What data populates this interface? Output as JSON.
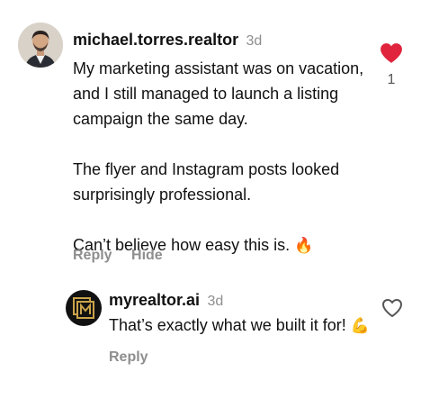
{
  "comment": {
    "avatar_alt": "profile photo",
    "username": "michael.torres.realtor",
    "time": "3d",
    "lines": [
      "My marketing assistant was on vacation,",
      "and I still managed to launch a listing",
      "campaign the same day."
    ],
    "lines2": [
      "The flyer and Instagram posts looked",
      "surprisingly professional."
    ],
    "last_line": "Can’t believe how easy this is.",
    "emoji": "🔥",
    "like_icon": "heart-filled-icon",
    "like_count": "1",
    "like_color": "#e0243d",
    "reply_label": "Reply",
    "hide_label": "Hide"
  },
  "reply": {
    "avatar_alt": "myrealtor.ai logo",
    "brand_color": "#c9a34a",
    "username": "myrealtor.ai",
    "time": "3d",
    "text": "That’s exactly what we built it for!",
    "emoji": "💪",
    "like_icon": "heart-outline-icon",
    "reply_label": "Reply"
  }
}
